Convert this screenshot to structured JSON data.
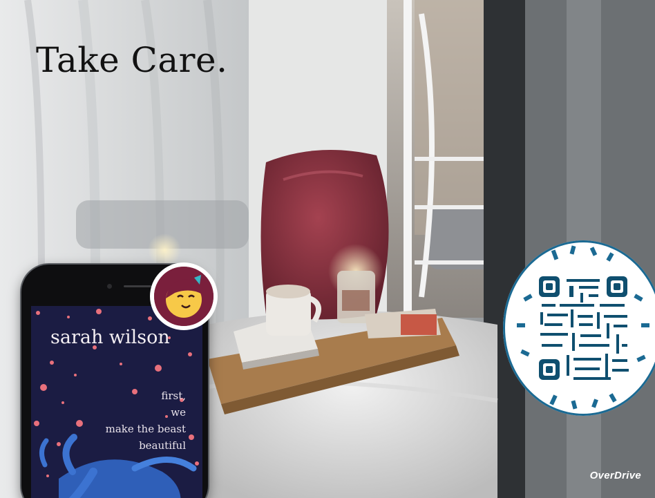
{
  "headline": "Take Care.",
  "phone": {
    "book_author": "sarah wilson",
    "book_title_lines": [
      "first,",
      "we",
      "make the beast",
      "beautiful"
    ]
  },
  "brand": "OverDrive",
  "colors": {
    "headline": "#121212",
    "book_cover": "#1a1a3e",
    "app_badge": "#7a1f3c",
    "qr_ring": "#1b6a93",
    "qr_dark": "#0f4f6f"
  },
  "icons": {
    "app_badge": "libby-app-icon",
    "qr_code": "qr-code-icon"
  }
}
